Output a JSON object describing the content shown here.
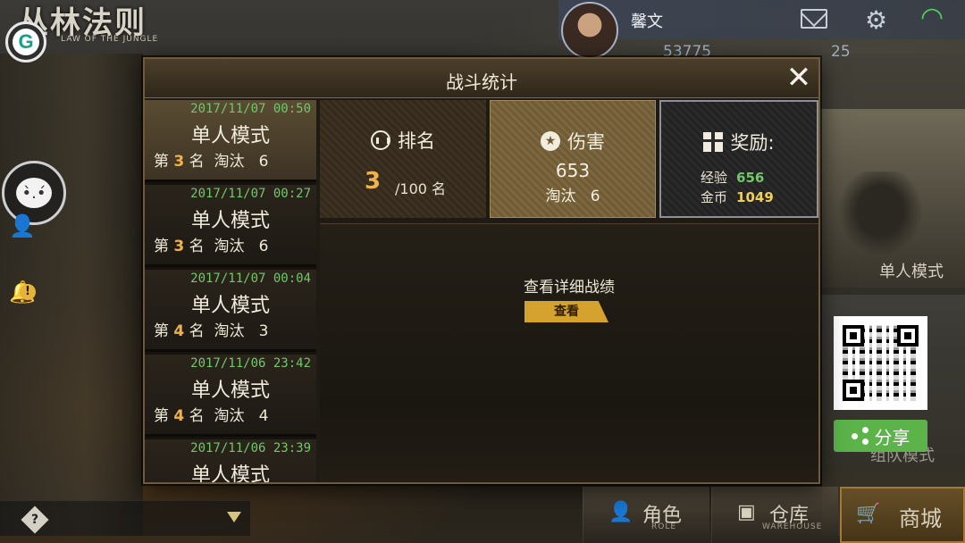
{
  "game": {
    "logo_title": "丛林法则",
    "logo_subtitle": "LAW OF THE JUNGLE",
    "g_button": "G"
  },
  "profile": {
    "username": "馨文",
    "currency_1": "53775",
    "currency_2": "25"
  },
  "modal": {
    "title": "战斗统计",
    "close": "✕",
    "history": [
      {
        "date": "2017/11/07 00:50",
        "mode": "单人模式",
        "prefix": "第 ",
        "rank": "3",
        "suffix": " 名  淘汰   6"
      },
      {
        "date": "2017/11/07 00:27",
        "mode": "单人模式",
        "prefix": "第 ",
        "rank": "3",
        "suffix": " 名  淘汰   6"
      },
      {
        "date": "2017/11/07 00:04",
        "mode": "单人模式",
        "prefix": "第 ",
        "rank": "4",
        "suffix": " 名  淘汰   3"
      },
      {
        "date": "2017/11/06 23:42",
        "mode": "单人模式",
        "prefix": "第 ",
        "rank": "4",
        "suffix": " 名  淘汰   4"
      },
      {
        "date": "2017/11/06 23:39",
        "mode": "单人模式",
        "prefix": "",
        "rank": "",
        "suffix": ""
      }
    ],
    "rank_box": {
      "title": "排名",
      "value": "3",
      "total": "/100 名"
    },
    "damage_box": {
      "title": "伤害",
      "value": "653",
      "kills": "淘汰   6"
    },
    "reward_box": {
      "title": "奖励:",
      "exp_label": "经验",
      "exp_value": "656",
      "gold_label": "金币",
      "gold_value": "1049"
    },
    "detail_text": "查看详细战绩",
    "view_button": "查看"
  },
  "right_panel": {
    "single_mode": "单人模式",
    "team_mode": "组队模式",
    "share_button": "分享"
  },
  "bottom_tabs": [
    {
      "label": "角色",
      "sub": "ROLE"
    },
    {
      "label": "仓库",
      "sub": "WAREHOUSE"
    },
    {
      "label": "商城",
      "sub": ""
    }
  ],
  "colors": {
    "accent_gold": "#d4a22d",
    "rank_orange": "#f0b24a",
    "date_green": "#73c76a",
    "share_green": "#5cb34a"
  }
}
